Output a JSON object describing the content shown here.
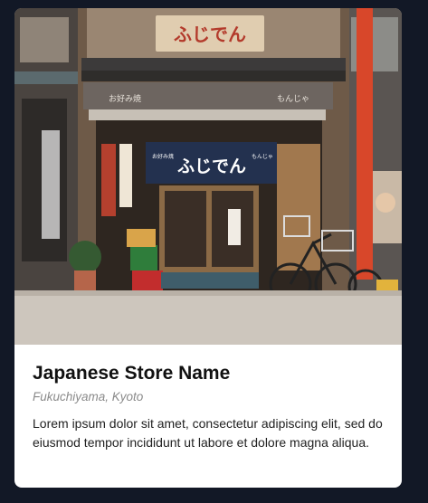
{
  "card": {
    "image_alt": "Japanese storefront with noren curtain reading ふじでん",
    "image_signs": {
      "roof_sign": "ふじでん",
      "curtain_main": "ふじでん",
      "curtain_left": "お好み焼",
      "curtain_right": "もんじゃ",
      "banner_left": "お好み焼",
      "banner_right": "もんじゃ"
    },
    "title": "Japanese Store Name",
    "location": "Fukuchiyama, Kyoto",
    "description": "Lorem ipsum dolor sit amet, consectetur adipiscing elit, sed do eiusmod tempor incididunt ut labore et dolore magna aliqua."
  },
  "colors": {
    "page_background": "#121826",
    "card_background": "#ffffff",
    "title": "#111111",
    "subtitle": "#8a8a8a",
    "text": "#222222",
    "noren": "#23314f",
    "red_pole": "#d8472a"
  }
}
